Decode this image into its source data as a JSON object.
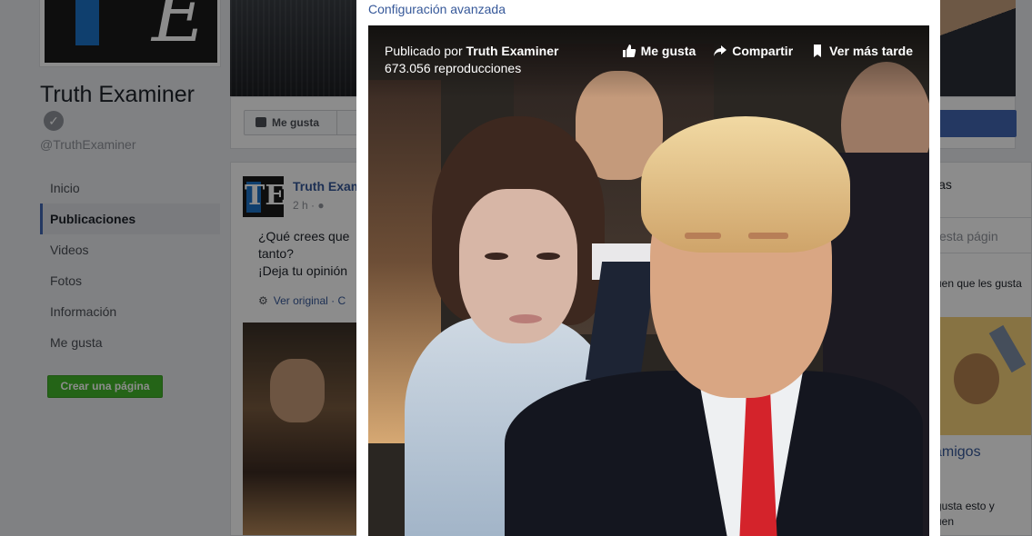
{
  "page": {
    "name": "Truth Examiner",
    "handle": "@TruthExaminer",
    "nav": [
      {
        "label": "Inicio"
      },
      {
        "label": "Publicaciones"
      },
      {
        "label": "Videos"
      },
      {
        "label": "Fotos"
      },
      {
        "label": "Información"
      },
      {
        "label": "Me gusta"
      }
    ],
    "active_nav": "Publicaciones",
    "create_page_label": "Crear una página",
    "like_button_label": "Me gusta"
  },
  "post": {
    "author": "Truth Exam",
    "time": "2 h ·",
    "text_line1": "¿Qué crees que",
    "text_line2": "tanto?",
    "text_line3": "¡Deja tu opinión",
    "see_original": "Ver original",
    "see_original_tail": "·  C"
  },
  "right_column": {
    "text1": "ias",
    "search_placeholder": "esta págin",
    "text2": "uen que les gusta",
    "friends_link": "amigos",
    "text4_line1": "gusta esto y",
    "text4_line2": "uen"
  },
  "modal": {
    "advanced_settings_link": "Configuración avanzada",
    "video": {
      "published_prefix": "Publicado por",
      "published_author": "Truth Examiner",
      "views": "673.056 reproducciones",
      "actions": {
        "like": "Me gusta",
        "share": "Compartir",
        "watch_later": "Ver más tarde"
      }
    }
  },
  "colors": {
    "facebook_blue": "#4267b2",
    "link_blue": "#365899",
    "green_button": "#42b72a",
    "overlay": "rgba(0,0,0,0.45)"
  }
}
